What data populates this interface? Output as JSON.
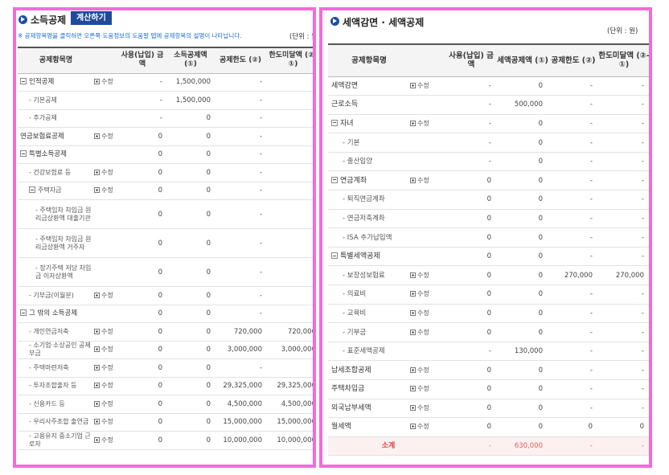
{
  "left": {
    "title": "소득공제",
    "calc_button": "계산하기",
    "notice": "※ 공제항목명을 클릭하면 오른쪽 도움정보의 도움말 탭에 공제항목의 설명이 나타납니다.",
    "unit": "(단위 : 원)",
    "headers": [
      "공제항목명",
      "",
      "사용(납입) 금액",
      "소득공제액 (①)",
      "공제한도 (②)",
      "한도미달액 (②-①)"
    ],
    "rows": [
      {
        "name": "인적공제",
        "level": 1,
        "toggle": true,
        "edit": "수정",
        "c1": "-",
        "c2": "1,500,000",
        "c3": "-",
        "c4": "-"
      },
      {
        "name": "- 기본공제",
        "level": 2,
        "c1": "-",
        "c2": "1,500,000",
        "c3": "-",
        "c4": "-"
      },
      {
        "name": "- 추가공제",
        "level": 2,
        "c1": "-",
        "c2": "0",
        "c3": "-",
        "c4": "-"
      },
      {
        "name": "연금보험료공제",
        "level": 1,
        "edit": "수정",
        "c1": "0",
        "c2": "0",
        "c3": "-",
        "c4": "-"
      },
      {
        "name": "특별소득공제",
        "level": 1,
        "toggle": true,
        "c1": "0",
        "c2": "0",
        "c3": "-",
        "c4": "-"
      },
      {
        "name": "- 건강보험료 등",
        "level": 2,
        "edit": "수정",
        "c1": "0",
        "c2": "0",
        "c3": "-",
        "c4": "-"
      },
      {
        "name": "주택자금",
        "level": 2,
        "toggle": true,
        "edit": "수정",
        "c1": "0",
        "c2": "0",
        "c3": "-",
        "c4": "-"
      },
      {
        "name": "- 주택임차 차입금 원리금상환액 대출기관",
        "level": 3,
        "c1": "0",
        "c2": "0",
        "c3": "-",
        "c4": "-"
      },
      {
        "name": "- 주택임차 차입금 원리금상환액 거주자",
        "level": 3,
        "c1": "0",
        "c2": "0",
        "c3": "-",
        "c4": "-"
      },
      {
        "name": "- 장기주택 저당 차입금 이자상환액",
        "level": 3,
        "c1": "0",
        "c2": "0",
        "c3": "-",
        "c4": "-"
      },
      {
        "name": "- 기부금(이월분)",
        "level": 2,
        "edit": "수정",
        "c1": "0",
        "c2": "0",
        "c3": "-",
        "c4": "-"
      },
      {
        "name": "그 밖의 소득공제",
        "level": 1,
        "toggle": true,
        "c1": "0",
        "c2": "0",
        "c3": "-",
        "c4": "-"
      },
      {
        "name": "- 개인연금저축",
        "level": 2,
        "edit": "수정",
        "c1": "0",
        "c2": "0",
        "c3": "720,000",
        "c4": "720,000"
      },
      {
        "name": "- 소기업·소상공인 공제부금",
        "level": 2,
        "edit": "수정",
        "c1": "0",
        "c2": "0",
        "c3": "3,000,000",
        "c4": "3,000,000"
      },
      {
        "name": "- 주택마련저축",
        "level": 2,
        "edit": "수정",
        "c1": "0",
        "c2": "0",
        "c3": "-",
        "c4": "-"
      },
      {
        "name": "- 투자조합출자 등",
        "level": 2,
        "edit": "수정",
        "c1": "0",
        "c2": "0",
        "c3": "29,325,000",
        "c4": "29,325,000"
      },
      {
        "name": "- 신용카드 등",
        "level": 2,
        "edit": "수정",
        "c1": "0",
        "c2": "0",
        "c3": "4,500,000",
        "c4": "4,500,000"
      },
      {
        "name": "- 우리사주조합 출연금",
        "level": 2,
        "edit": "수정",
        "c1": "0",
        "c2": "0",
        "c3": "15,000,000",
        "c4": "15,000,000"
      },
      {
        "name": "- 고용유지 중소기업 근로자",
        "level": 2,
        "edit": "수정",
        "c1": "0",
        "c2": "0",
        "c3": "10,000,000",
        "c4": "10,000,000"
      }
    ]
  },
  "right": {
    "title": "세액감면 · 세액공제",
    "unit": "(단위 : 원)",
    "headers": [
      "공제항목명",
      "",
      "사용(납입) 금액",
      "세액공제액 (①)",
      "공제한도 (②)",
      "한도미달액 (②-①)"
    ],
    "rows": [
      {
        "name": "세액감면",
        "level": 1,
        "edit": "수정",
        "c1": "-",
        "c2": "0",
        "c3": "-",
        "c4": "-"
      },
      {
        "name": "근로소득",
        "level": 1,
        "c1": "-",
        "c2": "500,000",
        "c3": "-",
        "c4": "-"
      },
      {
        "name": "자녀",
        "level": 1,
        "toggle": true,
        "edit": "수정",
        "c1": "-",
        "c2": "0",
        "c3": "-",
        "c4": "-"
      },
      {
        "name": "- 기본",
        "level": 2,
        "c1": "-",
        "c2": "0",
        "c3": "-",
        "c4": "-"
      },
      {
        "name": "- 출산입양",
        "level": 2,
        "c1": "-",
        "c2": "0",
        "c3": "-",
        "c4": "-"
      },
      {
        "name": "연금계좌",
        "level": 1,
        "toggle": true,
        "edit": "수정",
        "c1": "0",
        "c2": "0",
        "c3": "-",
        "c4": "-"
      },
      {
        "name": "- 퇴직연금계좌",
        "level": 2,
        "c1": "0",
        "c2": "0",
        "c3": "-",
        "c4": "-"
      },
      {
        "name": "- 연금저축계좌",
        "level": 2,
        "c1": "0",
        "c2": "0",
        "c3": "-",
        "c4": "-"
      },
      {
        "name": "- ISA 추가납입액",
        "level": 2,
        "c1": "0",
        "c2": "0",
        "c3": "-",
        "c4": "-"
      },
      {
        "name": "특별세액공제",
        "level": 1,
        "toggle": true,
        "c1": "0",
        "c2": "0",
        "c3": "-",
        "c4": "-"
      },
      {
        "name": "- 보장성보험료",
        "level": 2,
        "edit": "수정",
        "c1": "0",
        "c2": "0",
        "c3": "270,000",
        "c4": "270,000"
      },
      {
        "name": "- 의료비",
        "level": 2,
        "edit": "수정",
        "c1": "0",
        "c2": "0",
        "c3": "-",
        "c4": "-"
      },
      {
        "name": "- 교육비",
        "level": 2,
        "edit": "수정",
        "c1": "0",
        "c2": "0",
        "c3": "-",
        "c4": "-"
      },
      {
        "name": "- 기부금",
        "level": 2,
        "edit": "수정",
        "c1": "0",
        "c2": "0",
        "c3": "-",
        "c4": "-"
      },
      {
        "name": "- 표준세액공제",
        "level": 2,
        "c1": "-",
        "c2": "130,000",
        "c3": "-",
        "c4": "-"
      },
      {
        "name": "납세조합공제",
        "level": 1,
        "edit": "수정",
        "c1": "0",
        "c2": "0",
        "c3": "-",
        "c4": "-"
      },
      {
        "name": "주택차입금",
        "level": 1,
        "edit": "수정",
        "c1": "0",
        "c2": "0",
        "c3": "-",
        "c4": "-"
      },
      {
        "name": "외국납부세액",
        "level": 1,
        "edit": "수정",
        "c1": "0",
        "c2": "0",
        "c3": "-",
        "c4": "-"
      },
      {
        "name": "월세액",
        "level": 1,
        "edit": "수정",
        "c1": "0",
        "c2": "0",
        "c3": "0",
        "c4": "0"
      }
    ],
    "total": {
      "name": "소계",
      "c1": "-",
      "c2": "630,000",
      "c3": "-",
      "c4": "-"
    }
  }
}
